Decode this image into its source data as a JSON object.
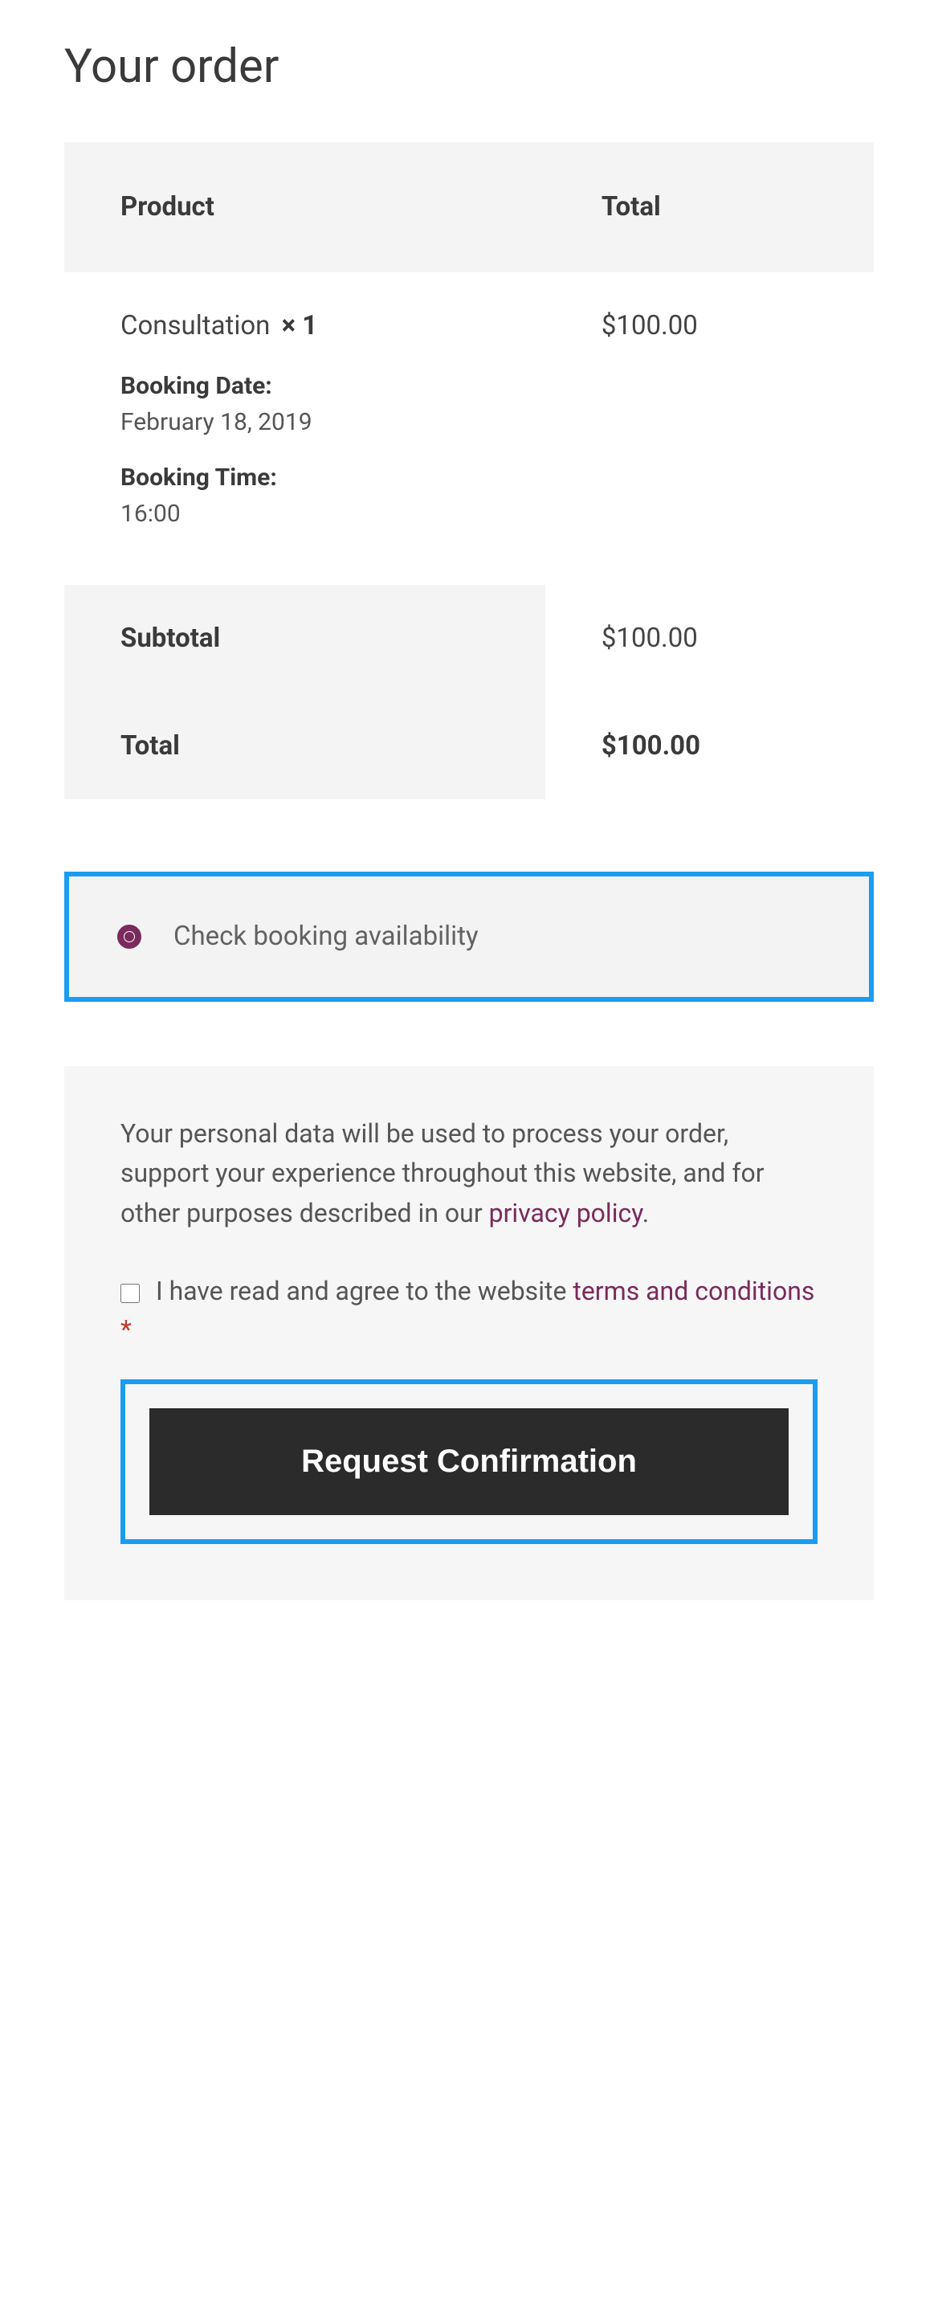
{
  "title": "Your order",
  "table": {
    "headers": {
      "product": "Product",
      "total": "Total"
    },
    "item": {
      "name": "Consultation",
      "qty": "× 1",
      "price": "$100.00",
      "booking_date_label": "Booking Date:",
      "booking_date_value": "February 18, 2019",
      "booking_time_label": "Booking Time:",
      "booking_time_value": "16:00"
    },
    "subtotal_label": "Subtotal",
    "subtotal_value": "$100.00",
    "total_label": "Total",
    "total_value": "$100.00"
  },
  "payment": {
    "option_label": "Check booking availability"
  },
  "privacy": {
    "text_before": "Your personal data will be used to process your order, support your experience throughout this website, and for other purposes described in our ",
    "link_text": "privacy policy",
    "text_after": "."
  },
  "terms": {
    "text_before": "I have read and agree to the website ",
    "link_text": "terms and conditions",
    "required_mark": "*"
  },
  "submit_label": "Request Confirmation"
}
